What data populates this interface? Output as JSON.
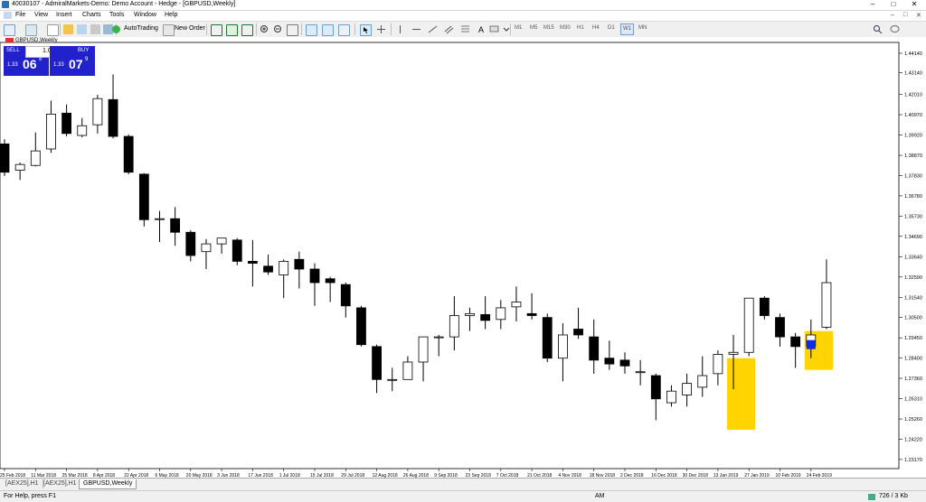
{
  "window": {
    "title": "40030107 - AdmiralMarkets-Demo: Demo Account - Hedge - [GBPUSD,Weekly]",
    "controls": [
      "–",
      "□",
      "✕"
    ]
  },
  "menu": {
    "items": [
      "File",
      "View",
      "Insert",
      "Charts",
      "Tools",
      "Window",
      "Help"
    ],
    "mdi_controls": [
      "–",
      "□",
      "✕"
    ]
  },
  "toolbar": {
    "autotrading_label": "AutoTrading",
    "new_order_label": "New Order",
    "timeframes": [
      "M1",
      "M5",
      "M15",
      "M30",
      "H1",
      "H4",
      "D1",
      "W1",
      "MN"
    ],
    "active_timeframe": "W1"
  },
  "chart": {
    "symbol_label": "GBPUSD,Weekly",
    "sell_label": "SELL",
    "buy_label": "BUY",
    "lot_value": "1.00",
    "sell_price": {
      "prefix": "1.33",
      "big": "06",
      "sup": "8"
    },
    "buy_price": {
      "prefix": "1.33",
      "big": "07",
      "sup": "9"
    }
  },
  "chart_data": {
    "type": "candlestick",
    "y_ticks": [
      "1.44140",
      "1.43140",
      "1.42010",
      "1.40970",
      "1.39920",
      "1.38870",
      "1.37830",
      "1.36780",
      "1.35730",
      "1.34690",
      "1.33640",
      "1.32590",
      "1.31540",
      "1.30500",
      "1.29450",
      "1.28400",
      "1.27360",
      "1.26310",
      "1.25260",
      "1.24220",
      "1.23170"
    ],
    "ylim": [
      1.227,
      1.447
    ],
    "x_labels": [
      "25 Feb 2018",
      "11 Mar 2018",
      "25 Mar 2018",
      "8 Apr 2018",
      "22 Apr 2018",
      "6 May 2018",
      "20 May 2018",
      "3 Jun 2018",
      "17 Jun 2018",
      "1 Jul 2018",
      "15 Jul 2018",
      "29 Jul 2018",
      "12 Aug 2018",
      "26 Aug 2018",
      "9 Sep 2018",
      "23 Sep 2018",
      "7 Oct 2018",
      "21 Oct 2018",
      "4 Nov 2018",
      "18 Nov 2018",
      "2 Dec 2018",
      "16 Dec 2018",
      "30 Dec 2018",
      "13 Jan 2019",
      "27 Jan 2019",
      "10 Feb 2019",
      "24 Feb 2019"
    ],
    "candles": [
      {
        "o": 1.3946,
        "h": 1.397,
        "l": 1.378,
        "c": 1.38
      },
      {
        "o": 1.381,
        "h": 1.385,
        "l": 1.376,
        "c": 1.384
      },
      {
        "o": 1.3835,
        "h": 1.4005,
        "l": 1.383,
        "c": 1.391
      },
      {
        "o": 1.392,
        "h": 1.417,
        "l": 1.39,
        "c": 1.41
      },
      {
        "o": 1.4105,
        "h": 1.415,
        "l": 1.3985,
        "c": 1.4
      },
      {
        "o": 1.399,
        "h": 1.408,
        "l": 1.398,
        "c": 1.404
      },
      {
        "o": 1.4045,
        "h": 1.42,
        "l": 1.4,
        "c": 1.418
      },
      {
        "o": 1.4175,
        "h": 1.4305,
        "l": 1.3975,
        "c": 1.3985
      },
      {
        "o": 1.3985,
        "h": 1.3995,
        "l": 1.379,
        "c": 1.38
      },
      {
        "o": 1.379,
        "h": 1.3795,
        "l": 1.352,
        "c": 1.3555
      },
      {
        "o": 1.356,
        "h": 1.36,
        "l": 1.344,
        "c": 1.356
      },
      {
        "o": 1.356,
        "h": 1.362,
        "l": 1.342,
        "c": 1.349
      },
      {
        "o": 1.349,
        "h": 1.35,
        "l": 1.334,
        "c": 1.337
      },
      {
        "o": 1.339,
        "h": 1.3455,
        "l": 1.33,
        "c": 1.343
      },
      {
        "o": 1.343,
        "h": 1.346,
        "l": 1.338,
        "c": 1.346
      },
      {
        "o": 1.345,
        "h": 1.346,
        "l": 1.332,
        "c": 1.334
      },
      {
        "o": 1.334,
        "h": 1.345,
        "l": 1.321,
        "c": 1.333
      },
      {
        "o": 1.3315,
        "h": 1.3375,
        "l": 1.327,
        "c": 1.3285
      },
      {
        "o": 1.327,
        "h": 1.335,
        "l": 1.315,
        "c": 1.334
      },
      {
        "o": 1.335,
        "h": 1.339,
        "l": 1.32,
        "c": 1.33
      },
      {
        "o": 1.33,
        "h": 1.333,
        "l": 1.311,
        "c": 1.323
      },
      {
        "o": 1.325,
        "h": 1.326,
        "l": 1.313,
        "c": 1.323
      },
      {
        "o": 1.322,
        "h": 1.323,
        "l": 1.305,
        "c": 1.311
      },
      {
        "o": 1.31,
        "h": 1.311,
        "l": 1.29,
        "c": 1.291
      },
      {
        "o": 1.29,
        "h": 1.291,
        "l": 1.266,
        "c": 1.273
      },
      {
        "o": 1.273,
        "h": 1.279,
        "l": 1.267,
        "c": 1.273
      },
      {
        "o": 1.273,
        "h": 1.285,
        "l": 1.273,
        "c": 1.282
      },
      {
        "o": 1.282,
        "h": 1.295,
        "l": 1.272,
        "c": 1.295
      },
      {
        "o": 1.295,
        "h": 1.296,
        "l": 1.285,
        "c": 1.295
      },
      {
        "o": 1.295,
        "h": 1.316,
        "l": 1.288,
        "c": 1.306
      },
      {
        "o": 1.306,
        "h": 1.31,
        "l": 1.298,
        "c": 1.307
      },
      {
        "o": 1.3065,
        "h": 1.316,
        "l": 1.299,
        "c": 1.3035
      },
      {
        "o": 1.304,
        "h": 1.314,
        "l": 1.299,
        "c": 1.31
      },
      {
        "o": 1.3105,
        "h": 1.321,
        "l": 1.303,
        "c": 1.313
      },
      {
        "o": 1.307,
        "h": 1.3175,
        "l": 1.304,
        "c": 1.306
      },
      {
        "o": 1.305,
        "h": 1.307,
        "l": 1.282,
        "c": 1.284
      },
      {
        "o": 1.284,
        "h": 1.302,
        "l": 1.272,
        "c": 1.296
      },
      {
        "o": 1.299,
        "h": 1.31,
        "l": 1.294,
        "c": 1.296
      },
      {
        "o": 1.295,
        "h": 1.304,
        "l": 1.276,
        "c": 1.283
      },
      {
        "o": 1.284,
        "h": 1.293,
        "l": 1.278,
        "c": 1.281
      },
      {
        "o": 1.283,
        "h": 1.287,
        "l": 1.276,
        "c": 1.28
      },
      {
        "o": 1.277,
        "h": 1.283,
        "l": 1.27,
        "c": 1.277
      },
      {
        "o": 1.275,
        "h": 1.276,
        "l": 1.252,
        "c": 1.263
      },
      {
        "o": 1.261,
        "h": 1.27,
        "l": 1.259,
        "c": 1.267
      },
      {
        "o": 1.265,
        "h": 1.276,
        "l": 1.259,
        "c": 1.271
      },
      {
        "o": 1.269,
        "h": 1.285,
        "l": 1.264,
        "c": 1.275
      },
      {
        "o": 1.276,
        "h": 1.288,
        "l": 1.27,
        "c": 1.286
      },
      {
        "o": 1.286,
        "h": 1.296,
        "l": 1.268,
        "c": 1.287
      },
      {
        "o": 1.287,
        "h": 1.315,
        "l": 1.285,
        "c": 1.315
      },
      {
        "o": 1.315,
        "h": 1.316,
        "l": 1.304,
        "c": 1.306
      },
      {
        "o": 1.305,
        "h": 1.307,
        "l": 1.29,
        "c": 1.295
      },
      {
        "o": 1.295,
        "h": 1.297,
        "l": 1.279,
        "c": 1.29
      },
      {
        "o": 1.29,
        "h": 1.304,
        "l": 1.284,
        "c": 1.296
      },
      {
        "o": 1.3,
        "h": 1.335,
        "l": 1.299,
        "c": 1.323
      }
    ],
    "highlights": [
      {
        "from_index": 47,
        "to_index": 48,
        "top": 1.284,
        "bottom": 1.247,
        "color": "#FFD400"
      },
      {
        "from_index": 52,
        "to_index": 53,
        "top": 1.298,
        "bottom": 1.278,
        "color": "#FFD400"
      }
    ],
    "marker": {
      "index": 52,
      "price": 1.291,
      "color": "#1030E0"
    },
    "bull_color": "#FFFFFF",
    "bear_color": "#000000"
  },
  "tabs": [
    "[AEX25],H1",
    "[AEX25],H1",
    "GBPUSD,Weekly"
  ],
  "active_tab": 2,
  "status": {
    "help": "For Help, press F1",
    "profile": "AM",
    "traffic": "726 / 3 Kb"
  }
}
